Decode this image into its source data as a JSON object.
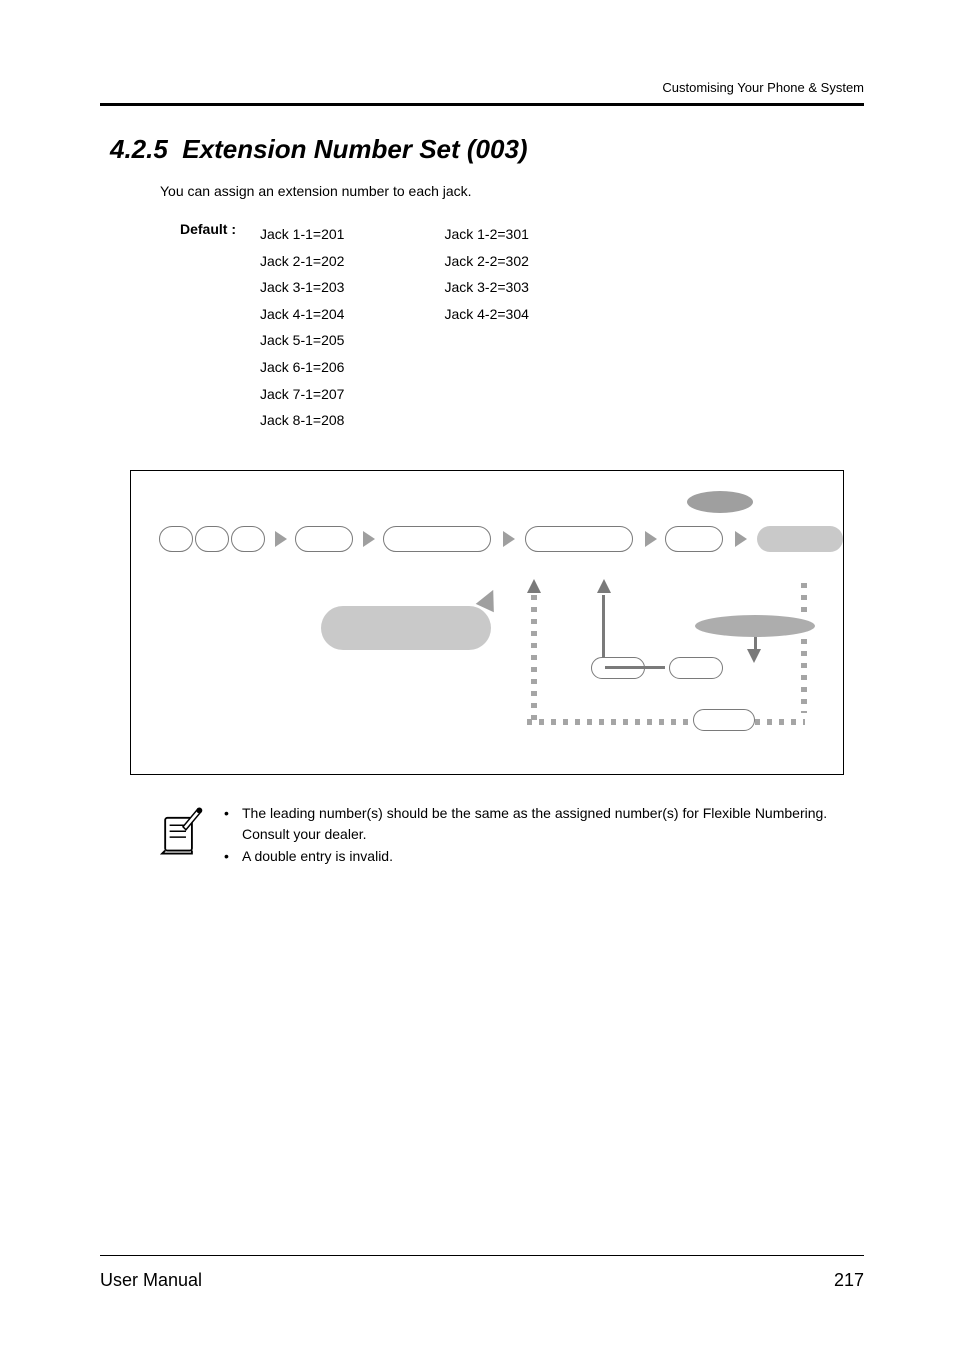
{
  "header": {
    "breadcrumb": "Customising Your Phone & System"
  },
  "section": {
    "number": "4.2.5",
    "title": "Extension Number Set (003)",
    "intro": "You can assign an extension number to each jack."
  },
  "defaults": {
    "label": "Default :",
    "col1": [
      "Jack 1-1=201",
      "Jack 2-1=202",
      "Jack 3-1=203",
      "Jack 4-1=204",
      "Jack 5-1=205",
      "Jack 6-1=206",
      "Jack 7-1=207",
      "Jack 8-1=208"
    ],
    "col2": [
      "Jack 1-2=301",
      "Jack 2-2=302",
      "Jack 3-2=303",
      "Jack 4-2=304"
    ]
  },
  "notes": {
    "bullets": [
      "The leading number(s) should be the same as the assigned number(s) for Flexible Numbering. Consult your dealer.",
      "A double entry is invalid."
    ]
  },
  "footer": {
    "left": "User Manual",
    "page": "217"
  }
}
